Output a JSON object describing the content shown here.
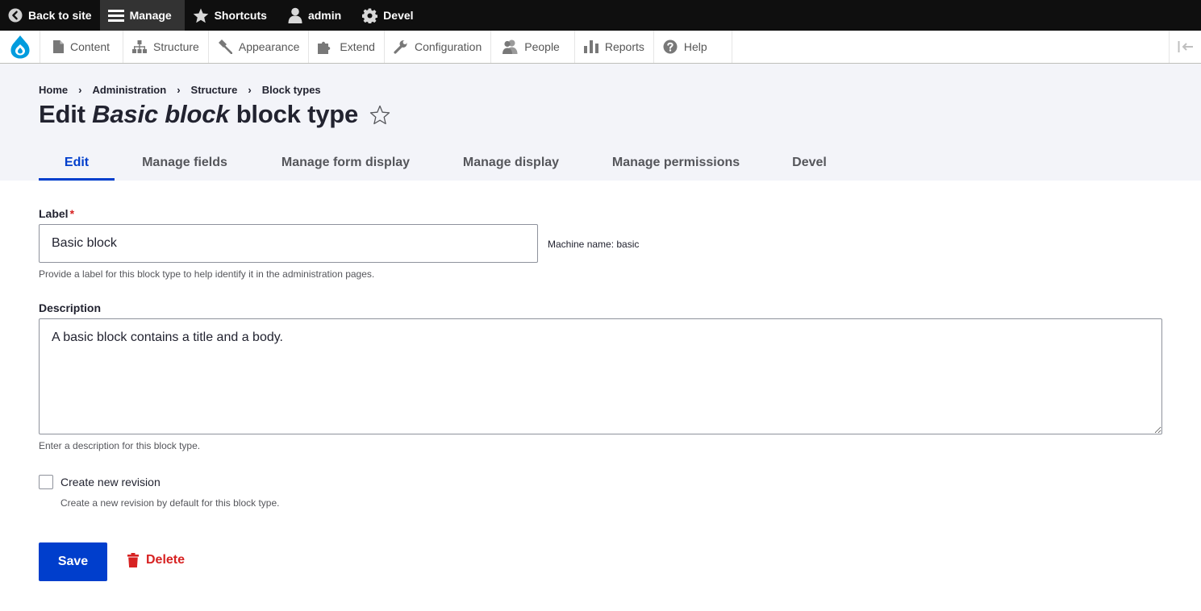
{
  "toolbar": {
    "back_to_site": "Back to site",
    "manage": "Manage",
    "shortcuts": "Shortcuts",
    "user": "admin",
    "devel": "Devel"
  },
  "tray": {
    "items": [
      {
        "label": "Content",
        "icon": "content-icon"
      },
      {
        "label": "Structure",
        "icon": "structure-icon"
      },
      {
        "label": "Appearance",
        "icon": "appearance-icon"
      },
      {
        "label": "Extend",
        "icon": "extend-icon"
      },
      {
        "label": "Configuration",
        "icon": "configuration-icon"
      },
      {
        "label": "People",
        "icon": "people-icon"
      },
      {
        "label": "Reports",
        "icon": "reports-icon"
      },
      {
        "label": "Help",
        "icon": "help-icon"
      }
    ]
  },
  "breadcrumb": [
    "Home",
    "Administration",
    "Structure",
    "Block types"
  ],
  "page": {
    "title_prefix": "Edit ",
    "title_em": "Basic block",
    "title_suffix": " block type"
  },
  "tabs": [
    {
      "label": "Edit",
      "active": true
    },
    {
      "label": "Manage fields",
      "active": false
    },
    {
      "label": "Manage form display",
      "active": false
    },
    {
      "label": "Manage display",
      "active": false
    },
    {
      "label": "Manage permissions",
      "active": false
    },
    {
      "label": "Devel",
      "active": false
    }
  ],
  "form": {
    "label_label": "Label",
    "label_required": "*",
    "label_value": "Basic block",
    "machine_name": "Machine name: basic",
    "label_help": "Provide a label for this block type to help identify it in the administration pages.",
    "description_label": "Description",
    "description_value": "A basic block contains a title and a body.",
    "description_help": "Enter a description for this block type.",
    "revision_label": "Create new revision",
    "revision_checked": false,
    "revision_help": "Create a new revision by default for this block type.",
    "save": "Save",
    "delete": "Delete"
  },
  "colors": {
    "toolbar_bg": "#0f0f0f",
    "accent_blue": "#003ecc",
    "danger_red": "#d72222",
    "header_bg": "#f3f4f9"
  }
}
